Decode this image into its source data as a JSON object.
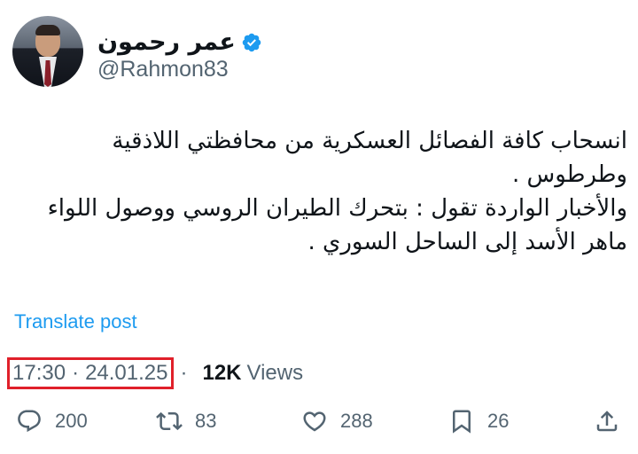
{
  "author": {
    "name": "عمر رحمون",
    "handle": "@Rahmon83"
  },
  "post": {
    "text": "انسحاب كافة الفصائل العسكرية من محافظتي اللاذقية وطرطوس .\nوالأخبار الواردة تقول : بتحرك الطيران الروسي ووصول اللواء ماهر الأسد إلى الساحل السوري ."
  },
  "translate_label": "Translate post",
  "meta": {
    "time": "17:30",
    "separator": "·",
    "date": "24.01.25",
    "views_count": "12K",
    "views_label": "Views"
  },
  "actions": {
    "replies": "200",
    "reposts": "83",
    "likes": "288",
    "bookmarks": "26"
  },
  "colors": {
    "link": "#1d9bf0",
    "secondary_text": "#536471",
    "highlight_box": "#e0202a"
  }
}
